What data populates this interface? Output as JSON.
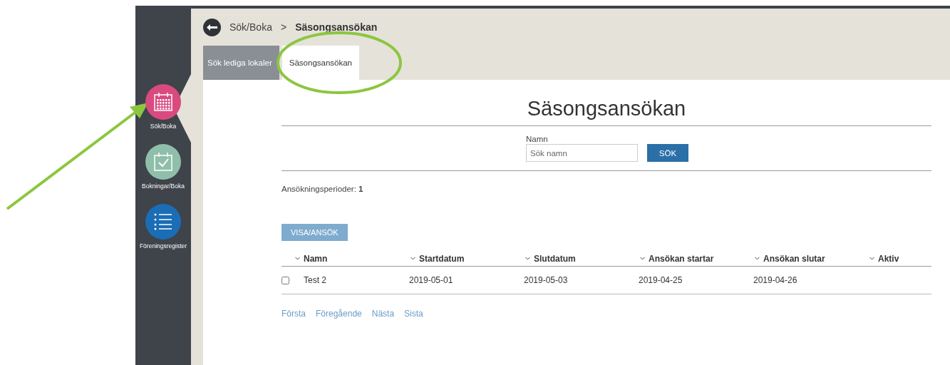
{
  "sidebar": {
    "items": [
      {
        "label": "Sök/Boka",
        "kind": "calendar",
        "color": "#d94a7f",
        "selected": true
      },
      {
        "label": "Bokningar/Boka",
        "kind": "check",
        "color": "#8fbfab",
        "selected": false
      },
      {
        "label": "Föreningsregister",
        "kind": "list",
        "color": "#1b6db6",
        "selected": false
      }
    ]
  },
  "breadcrumb": {
    "parent": "Sök/Boka",
    "separator": ">",
    "current": "Säsongsansökan"
  },
  "tabs": [
    {
      "label": "Sök lediga lokaler",
      "selected": false
    },
    {
      "label": "Säsongsansökan",
      "selected": true
    }
  ],
  "page_title": "Säsongsansökan",
  "search": {
    "label": "Namn",
    "placeholder": "Sök namn",
    "button": "SÖK"
  },
  "periods": {
    "label": "Ansökningsperioder:",
    "count": "1"
  },
  "action_button": "VISA/ANSÖK",
  "table": {
    "columns": [
      "Namn",
      "Startdatum",
      "Slutdatum",
      "Ansökan startar",
      "Ansökan slutar",
      "Aktiv"
    ],
    "rows": [
      {
        "checked": false,
        "cells": [
          "Test 2",
          "2019-05-01",
          "2019-05-03",
          "2019-04-25",
          "2019-04-26"
        ]
      }
    ]
  },
  "pagination": [
    "Första",
    "Föregående",
    "Nästa",
    "Sista"
  ]
}
